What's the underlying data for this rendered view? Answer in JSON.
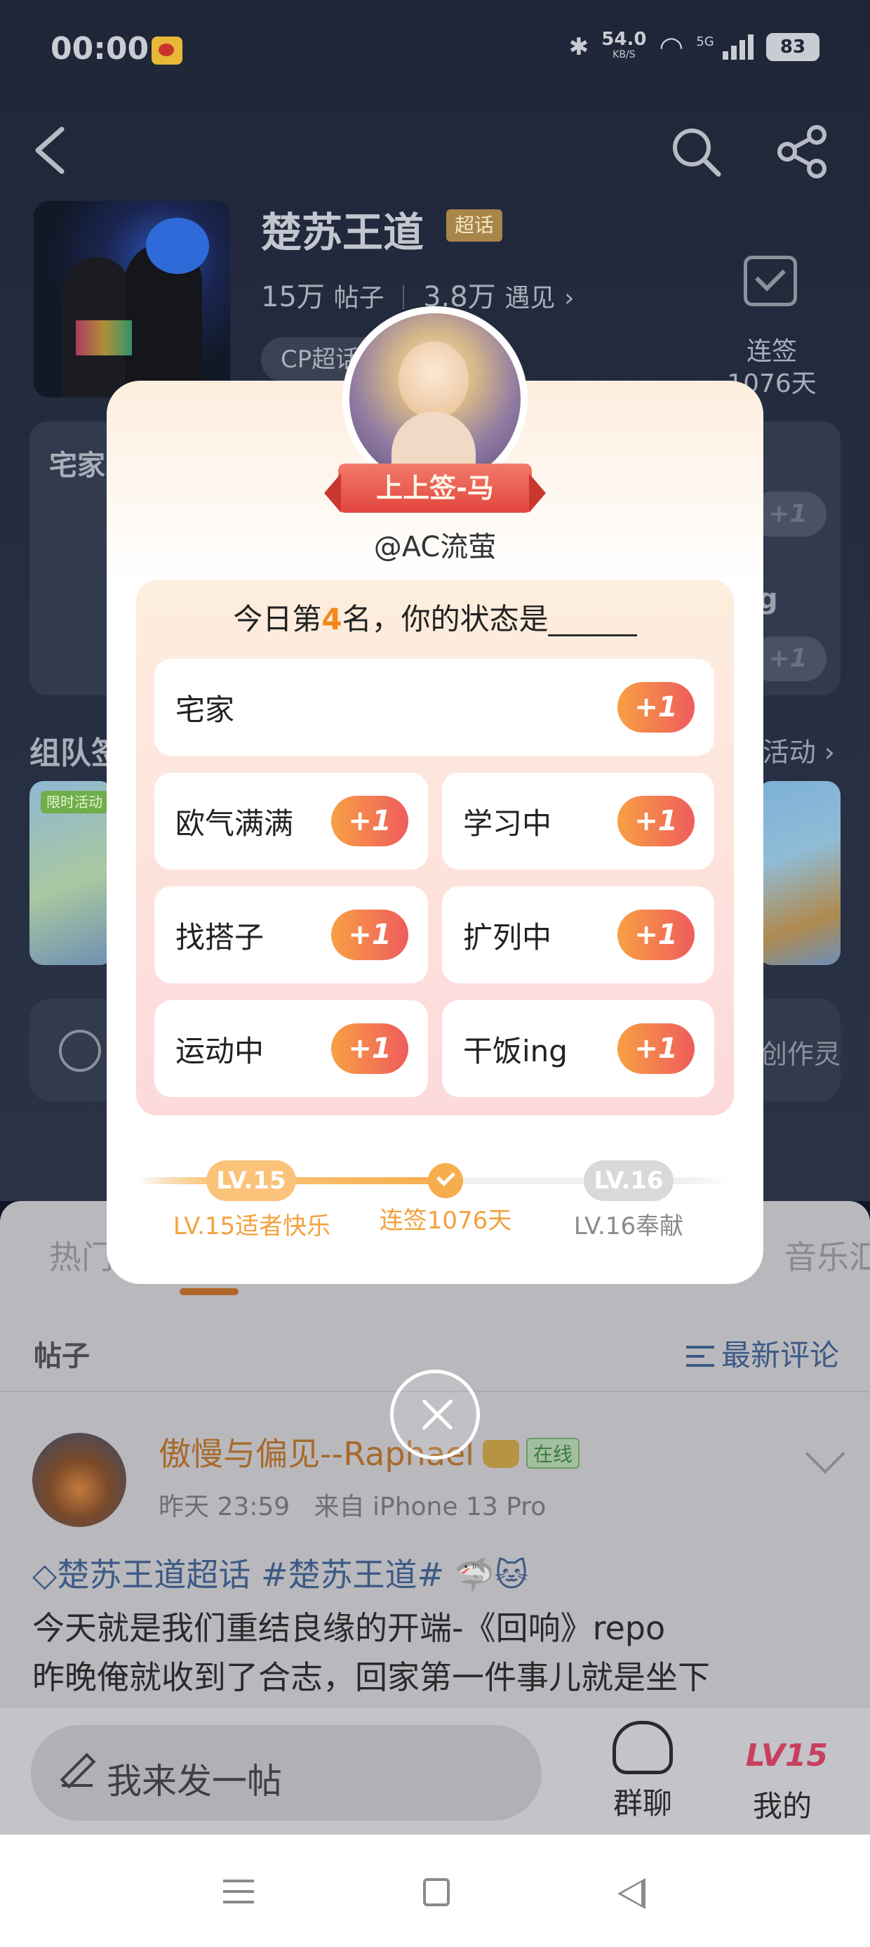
{
  "status_bar": {
    "time": "00:00",
    "net_speed_value": "54.0",
    "net_speed_unit": "KB/S",
    "network_type": "5G",
    "battery": "83"
  },
  "topic": {
    "title": "楚苏王道",
    "super_badge": "超话",
    "posts_count": "15万",
    "posts_unit": "帖子",
    "encounters_count": "3.8万",
    "encounters_unit": "遇见",
    "cp_tag": "CP超话",
    "checkin_label": "连签",
    "checkin_days": "1076天"
  },
  "background": {
    "card_title": "宅家",
    "plus_label": "+1",
    "ing_fragment": "g",
    "team_title": "组队签",
    "more_activity": "活动",
    "limited_tag": "限时活动",
    "creator_text": "创作灵"
  },
  "modal": {
    "fortune": "上上签-马",
    "username": "@AC流萤",
    "question_prefix": "今日第",
    "rank": "4",
    "question_suffix": "名，你的状态是______",
    "options": [
      {
        "label": "宅家",
        "plus": "+1"
      },
      {
        "label": "欧气满满",
        "plus": "+1"
      },
      {
        "label": "学习中",
        "plus": "+1"
      },
      {
        "label": "找搭子",
        "plus": "+1"
      },
      {
        "label": "扩列中",
        "plus": "+1"
      },
      {
        "label": "运动中",
        "plus": "+1"
      },
      {
        "label": "干饭ing",
        "plus": "+1"
      }
    ],
    "level": {
      "current_badge": "LV.15",
      "current_label": "LV.15适者快乐",
      "mid_label": "连签1076天",
      "next_badge": "LV.16",
      "next_label": "LV.16奉献"
    }
  },
  "feed": {
    "tab_hot": "热门",
    "tab_music": "音乐汇",
    "posts_label": "帖子",
    "sort_label": "最新评论",
    "post": {
      "author": "傲慢与偏见--Raphael",
      "online": "在线",
      "time": "昨天 23:59",
      "source": "来自 iPhone 13 Pro",
      "hashtags": "楚苏王道超话 #楚苏王道# 🦈🐱",
      "line1": "今天就是我们重结良缘的开端-《回响》repo",
      "line2": "昨晚俺就收到了合志，回家第一件事儿就是坐下"
    }
  },
  "bottom_bar": {
    "compose_placeholder": "我来发一帖",
    "group_chat": "群聊",
    "my_level": "LV15",
    "mine": "我的"
  },
  "colors": {
    "accent_orange": "#f6ad4c",
    "plus_gradient_start": "#f7a044",
    "plus_gradient_end": "#ef5c5c",
    "link_blue": "#3d5a85",
    "fortune_red": "#e2463e"
  },
  "icons": [
    "back-icon",
    "search-icon",
    "share-icon",
    "calendar-check-icon",
    "close-icon",
    "pen-icon",
    "group-chat-icon",
    "sort-icon",
    "check-icon"
  ]
}
